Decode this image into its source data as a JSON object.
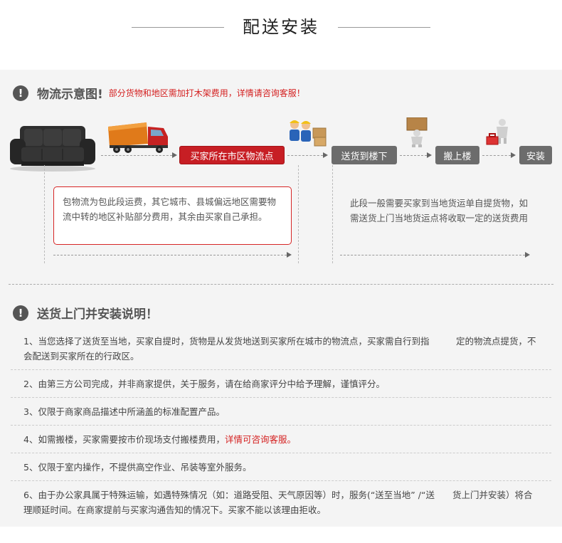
{
  "header": {
    "title": "配送安装"
  },
  "flow_section": {
    "title": "物流示意图!",
    "note": "部分货物和地区需加打木架费用，详情请咨询客服！",
    "steps": [
      {
        "label": "买家所在市区物流点"
      },
      {
        "label": "送货到楼下"
      },
      {
        "label": "搬上楼"
      },
      {
        "label": "安装"
      }
    ],
    "left_box_text": "包物流为包此段运费，其它城市、县城偏远地区需要物流中转的地区补贴部分费用，其余由买家自己承担。",
    "right_text": "此段一般需要买家到当地货运单自提货物，如需送货上门当地货运点将收取一定的送货费用"
  },
  "install_section": {
    "title": "送货上门并安装说明！",
    "items": [
      {
        "text": "1、当您选择了送货至当地，买家自提时，货物是从发货地送到买家所在城市的物流点，买家需自行到指　　　定的物流点提货，不会配送到买家所在的行政区。"
      },
      {
        "text": "2、由第三方公司完成，并非商家提供，关于服务，请在给商家评分中给予理解，谨慎评分。"
      },
      {
        "text": "3、仅限于商家商品描述中所涵盖的标准配置产品。"
      },
      {
        "text": "4、如需搬楼，买家需要按市价现场支付搬楼费用，",
        "highlight": "详情可咨询客服。"
      },
      {
        "text": "5、仅限于室内操作，不提供高空作业、吊装等室外服务。"
      },
      {
        "text": "6、由于办公家具属于特殊运输，如遇特殊情况（如：道路受阻、天气原因等）时，服务(“送至当地” /“送　　货上门并安装）将合理顺延时间。在商家提前与买家沟通告知的情况下。买家不能以该理由拒收。"
      }
    ]
  },
  "colors": {
    "accent_red": "#c71e24",
    "step_gray": "#6c6c6c",
    "panel_bg": "#f4f4f4"
  },
  "icons": [
    "alert-icon",
    "sofa-icon",
    "truck-icon",
    "workers-icon",
    "carrier-icon",
    "tools-icon"
  ]
}
